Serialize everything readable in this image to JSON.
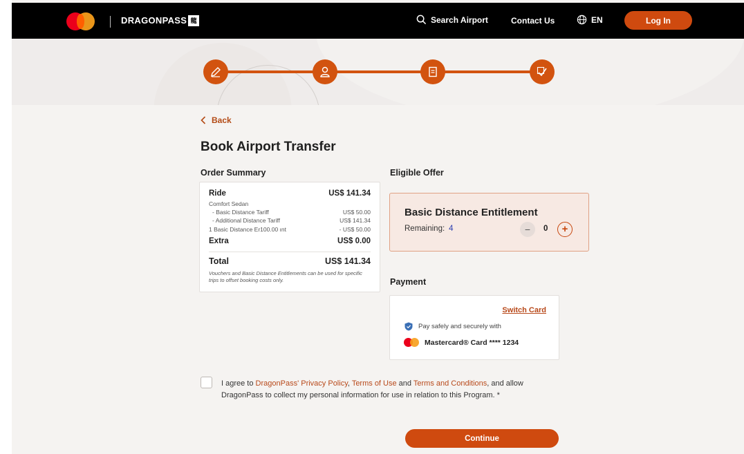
{
  "header": {
    "brand": "DRAGONPASS",
    "brand_mark": "龍",
    "search_label": "Search Airport",
    "contact_label": "Contact Us",
    "lang_label": "EN",
    "login_label": "Log In",
    "icons": [
      "mastercard-logo",
      "search-icon",
      "globe-icon"
    ]
  },
  "progress": {
    "steps": [
      {
        "icon": "pencil-icon",
        "state": "active"
      },
      {
        "icon": "user-icon",
        "state": "active"
      },
      {
        "icon": "document-icon",
        "state": "active"
      },
      {
        "icon": "confirm-icon",
        "state": "active"
      }
    ]
  },
  "page": {
    "back_label": "Back",
    "title": "Book Airport Transfer"
  },
  "order_summary": {
    "heading": "Order Summary",
    "ride_label": "Ride",
    "ride_total": "US$ 141.34",
    "vehicle": "Comfort Sedan",
    "items": [
      {
        "label": "- Basic Distance Tariff",
        "value": "US$ 50.00"
      },
      {
        "label": "- Additional Distance Tariff",
        "value": "US$ 141.34"
      },
      {
        "label": "1 Basic Distance Er100.00  ınt",
        "value": "- US$ 50.00"
      }
    ],
    "extra_label": "Extra",
    "extra_value": "US$ 0.00",
    "total_label": "Total",
    "total_value": "US$ 141.34",
    "note": "Vouchers and Basic Distance Entitlements can be used for specific trips to offset booking costs only."
  },
  "offer": {
    "heading": "Eligible Offer",
    "title": "Basic Distance Entitlement",
    "remaining_label": "Remaining:",
    "remaining_value": "4",
    "quantity": "0",
    "minus_symbol": "−",
    "plus_symbol": "+"
  },
  "payment": {
    "heading": "Payment",
    "switch_label": "Switch Card",
    "safe_text": "Pay safely and securely with",
    "card_text": "Mastercard® Card **** 1234"
  },
  "agreement": {
    "t1": "I agree to ",
    "link1": "DragonPass' Privacy Policy",
    "t2": ", ",
    "link2": "Terms of Use",
    "t3": " and ",
    "link3": "Terms and Conditions",
    "t4": ", and allow DragonPass to collect my personal information for use in relation to this Program. *"
  },
  "continue_label": "Continue",
  "colors": {
    "accent": "#cf4a0f",
    "header_bg": "#000000",
    "page_bg": "#f5f3f1",
    "offer_bg": "#f7e9e3",
    "link": "#b8491a"
  }
}
